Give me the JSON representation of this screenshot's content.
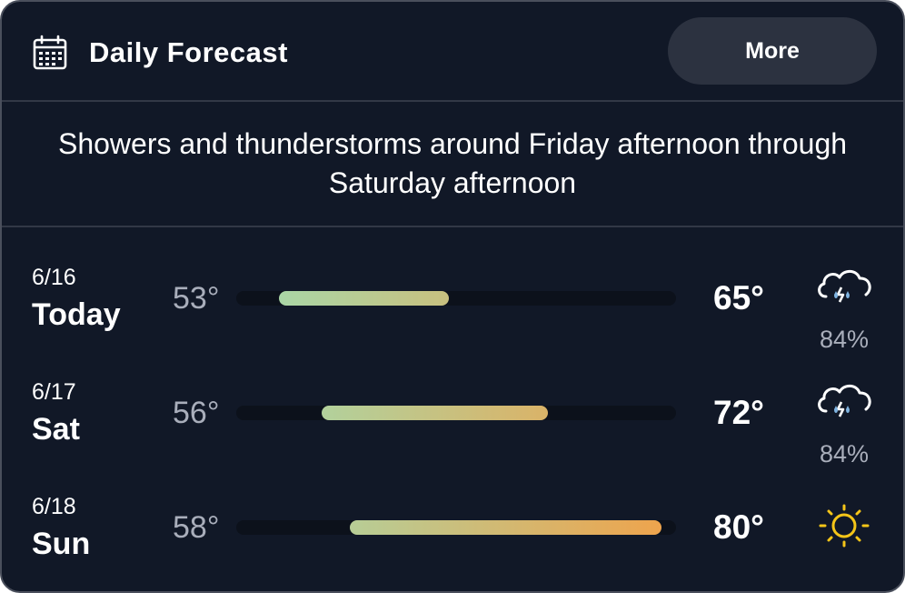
{
  "header": {
    "icon": "calendar-icon",
    "title": "Daily Forecast",
    "more_label": "More"
  },
  "summary": "Showers and thunderstorms around Friday afternoon through Saturday afternoon",
  "scale": {
    "min": 50,
    "max": 81
  },
  "colors": {
    "background": "#111827",
    "bar_cool": "#a3dcb0",
    "bar_warm": "#f0a24a",
    "sun": "#f5c518",
    "rain_drop": "#7fb3e0"
  },
  "days": [
    {
      "date": "6/16",
      "name": "Today",
      "low": "53°",
      "high": "65°",
      "low_value": 53,
      "high_value": 65,
      "icon": "thunderstorm-icon",
      "precip": "84%"
    },
    {
      "date": "6/17",
      "name": "Sat",
      "low": "56°",
      "high": "72°",
      "low_value": 56,
      "high_value": 72,
      "icon": "thunderstorm-icon",
      "precip": "84%"
    },
    {
      "date": "6/18",
      "name": "Sun",
      "low": "58°",
      "high": "80°",
      "low_value": 58,
      "high_value": 80,
      "icon": "sun-icon",
      "precip": ""
    }
  ]
}
